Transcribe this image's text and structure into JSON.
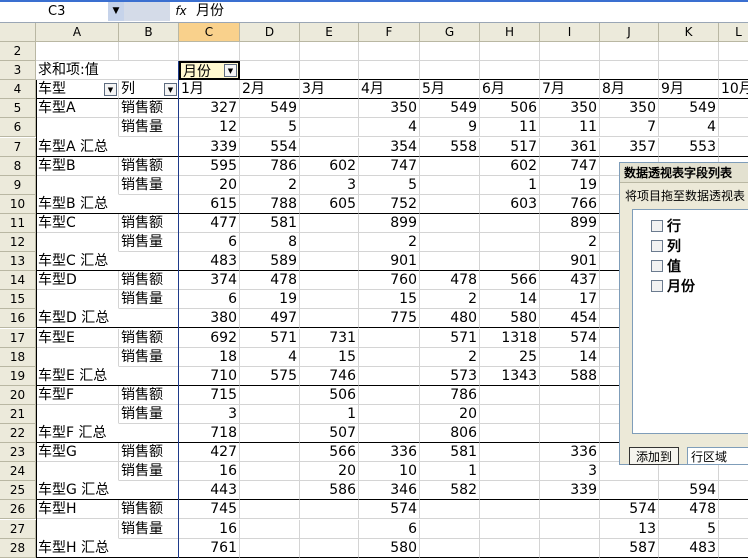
{
  "formula_bar": {
    "cell_ref": "C3",
    "fx": "fx",
    "content": "月份"
  },
  "columns": [
    "A",
    "B",
    "C",
    "D",
    "E",
    "F",
    "G",
    "H",
    "I",
    "J",
    "K",
    "L"
  ],
  "selected_column": "C",
  "pivot": {
    "label_sum": "求和项:值",
    "month_field": "月份",
    "row_field_1": "车型",
    "row_field_2": "列",
    "months": [
      "1月",
      "2月",
      "3月",
      "4月",
      "5月",
      "6月",
      "7月",
      "8月",
      "9月",
      "10月"
    ]
  },
  "rows": [
    {
      "n": "2",
      "type": "blank"
    },
    {
      "n": "3",
      "type": "filter"
    },
    {
      "n": "4",
      "type": "header"
    },
    {
      "n": "5",
      "a": "车型A",
      "b": "销售额",
      "v": [
        "327",
        "549",
        "",
        "350",
        "549",
        "506",
        "350",
        "350",
        "549",
        ""
      ]
    },
    {
      "n": "6",
      "a": "",
      "b": "销售量",
      "v": [
        "12",
        "5",
        "",
        "4",
        "9",
        "11",
        "11",
        "7",
        "4",
        ""
      ]
    },
    {
      "n": "7",
      "a": "车型A 汇总",
      "b": "",
      "v": [
        "339",
        "554",
        "",
        "354",
        "558",
        "517",
        "361",
        "357",
        "553",
        ""
      ],
      "total": true
    },
    {
      "n": "8",
      "a": "车型B",
      "b": "销售额",
      "v": [
        "595",
        "786",
        "602",
        "747",
        "",
        "602",
        "747",
        "",
        "",
        ""
      ]
    },
    {
      "n": "9",
      "a": "",
      "b": "销售量",
      "v": [
        "20",
        "2",
        "3",
        "5",
        "",
        "1",
        "19",
        "",
        "",
        ""
      ]
    },
    {
      "n": "10",
      "a": "车型B 汇总",
      "b": "",
      "v": [
        "615",
        "788",
        "605",
        "752",
        "",
        "603",
        "766",
        "",
        "",
        ""
      ],
      "total": true
    },
    {
      "n": "11",
      "a": "车型C",
      "b": "销售额",
      "v": [
        "477",
        "581",
        "",
        "899",
        "",
        "",
        "899",
        "",
        "",
        ""
      ]
    },
    {
      "n": "12",
      "a": "",
      "b": "销售量",
      "v": [
        "6",
        "8",
        "",
        "2",
        "",
        "",
        "2",
        "",
        "",
        ""
      ]
    },
    {
      "n": "13",
      "a": "车型C 汇总",
      "b": "",
      "v": [
        "483",
        "589",
        "",
        "901",
        "",
        "",
        "901",
        "",
        "",
        ""
      ],
      "total": true
    },
    {
      "n": "14",
      "a": "车型D",
      "b": "销售额",
      "v": [
        "374",
        "478",
        "",
        "760",
        "478",
        "566",
        "437",
        "",
        "",
        ""
      ]
    },
    {
      "n": "15",
      "a": "",
      "b": "销售量",
      "v": [
        "6",
        "19",
        "",
        "15",
        "2",
        "14",
        "17",
        "",
        "",
        ""
      ]
    },
    {
      "n": "16",
      "a": "车型D 汇总",
      "b": "",
      "v": [
        "380",
        "497",
        "",
        "775",
        "480",
        "580",
        "454",
        "",
        "",
        ""
      ],
      "total": true
    },
    {
      "n": "17",
      "a": "车型E",
      "b": "销售额",
      "v": [
        "692",
        "571",
        "731",
        "",
        "571",
        "1318",
        "574",
        "",
        "",
        ""
      ]
    },
    {
      "n": "18",
      "a": "",
      "b": "销售量",
      "v": [
        "18",
        "4",
        "15",
        "",
        "2",
        "25",
        "14",
        "",
        "",
        ""
      ]
    },
    {
      "n": "19",
      "a": "车型E 汇总",
      "b": "",
      "v": [
        "710",
        "575",
        "746",
        "",
        "573",
        "1343",
        "588",
        "",
        "",
        ""
      ],
      "total": true
    },
    {
      "n": "20",
      "a": "车型F",
      "b": "销售额",
      "v": [
        "715",
        "",
        "506",
        "",
        "786",
        "",
        "",
        "",
        "",
        ""
      ]
    },
    {
      "n": "21",
      "a": "",
      "b": "销售量",
      "v": [
        "3",
        "",
        "1",
        "",
        "20",
        "",
        "",
        "",
        "",
        ""
      ]
    },
    {
      "n": "22",
      "a": "车型F 汇总",
      "b": "",
      "v": [
        "718",
        "",
        "507",
        "",
        "806",
        "",
        "",
        "",
        "",
        ""
      ],
      "total": true
    },
    {
      "n": "23",
      "a": "车型G",
      "b": "销售额",
      "v": [
        "427",
        "",
        "566",
        "336",
        "581",
        "",
        "336",
        "",
        "",
        ""
      ]
    },
    {
      "n": "24",
      "a": "",
      "b": "销售量",
      "v": [
        "16",
        "",
        "20",
        "10",
        "1",
        "",
        "3",
        "",
        "",
        ""
      ]
    },
    {
      "n": "25",
      "a": "车型G 汇总",
      "b": "",
      "v": [
        "443",
        "",
        "586",
        "346",
        "582",
        "",
        "339",
        "",
        "594",
        ""
      ],
      "total": true
    },
    {
      "n": "26",
      "a": "车型H",
      "b": "销售额",
      "v": [
        "745",
        "",
        "",
        "574",
        "",
        "",
        "",
        "574",
        "478",
        ""
      ]
    },
    {
      "n": "27",
      "a": "",
      "b": "销售量",
      "v": [
        "16",
        "",
        "",
        "6",
        "",
        "",
        "",
        "13",
        "5",
        ""
      ]
    },
    {
      "n": "28",
      "a": "车型H 汇总",
      "b": "",
      "v": [
        "761",
        "",
        "",
        "580",
        "",
        "",
        "",
        "587",
        "483",
        ""
      ],
      "total": true
    }
  ],
  "field_list": {
    "title": "数据透视表字段列表",
    "subtitle": "将项目拖至数据透视表",
    "fields": [
      "行",
      "列",
      "值",
      "月份"
    ],
    "add_button": "添加到",
    "area": "行区域"
  }
}
